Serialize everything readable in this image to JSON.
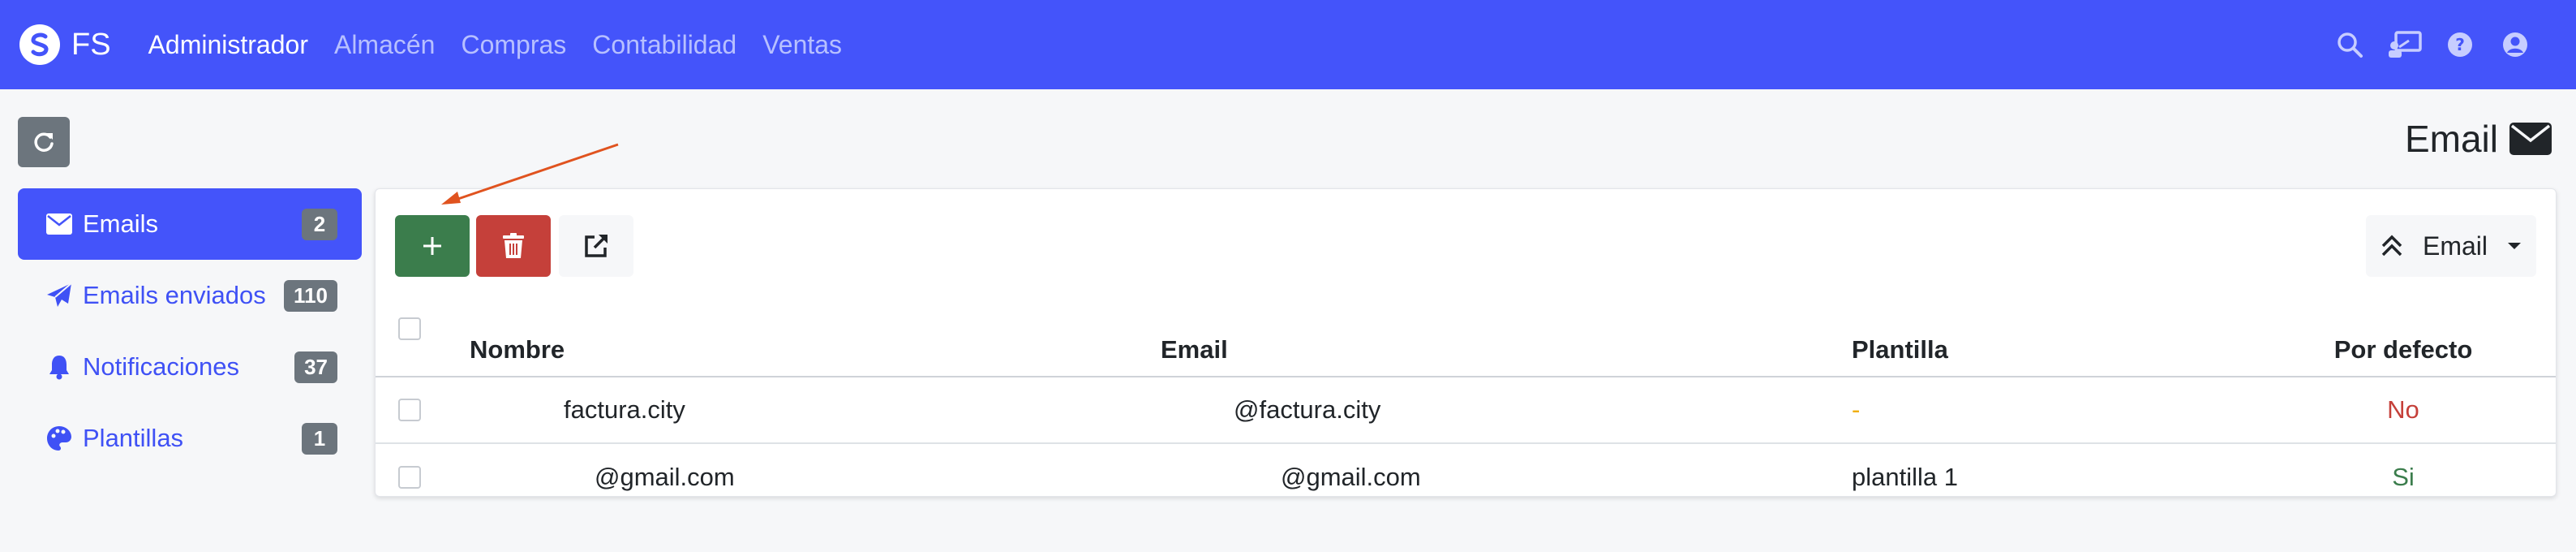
{
  "navbar": {
    "brand": "FS",
    "menu": [
      {
        "label": "Administrador",
        "active": true
      },
      {
        "label": "Almacén",
        "active": false
      },
      {
        "label": "Compras",
        "active": false
      },
      {
        "label": "Contabilidad",
        "active": false
      },
      {
        "label": "Ventas",
        "active": false
      }
    ],
    "icons": [
      "search-icon",
      "presentation-icon",
      "help-icon",
      "user-icon"
    ]
  },
  "page": {
    "title": "Email",
    "title_icon": "envelope-icon"
  },
  "sidebar": {
    "items": [
      {
        "label": "Emails",
        "count": "2",
        "icon": "envelope-icon",
        "active": true
      },
      {
        "label": "Emails enviados",
        "count": "110",
        "icon": "paper-plane-icon",
        "active": false
      },
      {
        "label": "Notificaciones",
        "count": "37",
        "icon": "bell-icon",
        "active": false
      },
      {
        "label": "Plantillas",
        "count": "1",
        "icon": "palette-icon",
        "active": false
      }
    ]
  },
  "toolbar": {
    "add_icon": "plus-icon",
    "delete_icon": "trash-icon",
    "link_icon": "external-link-icon",
    "sort_label": "Email",
    "sort_icon": "double-chevron-up-icon"
  },
  "table": {
    "headers": {
      "nombre": "Nombre",
      "email": "Email",
      "plantilla": "Plantilla",
      "por_defecto": "Por defecto"
    },
    "rows": [
      {
        "nombre": "factura.city",
        "email": "@factura.city",
        "plantilla": "-",
        "por_defecto": "No"
      },
      {
        "nombre": "@gmail.com",
        "email": "@gmail.com",
        "plantilla": "plantilla 1",
        "por_defecto": "Si"
      }
    ]
  },
  "colors": {
    "navbar": "#4454fa",
    "add": "#3b7d4c",
    "delete": "#c5403a",
    "badge": "#6c757d",
    "arrow": "#e0531f"
  }
}
